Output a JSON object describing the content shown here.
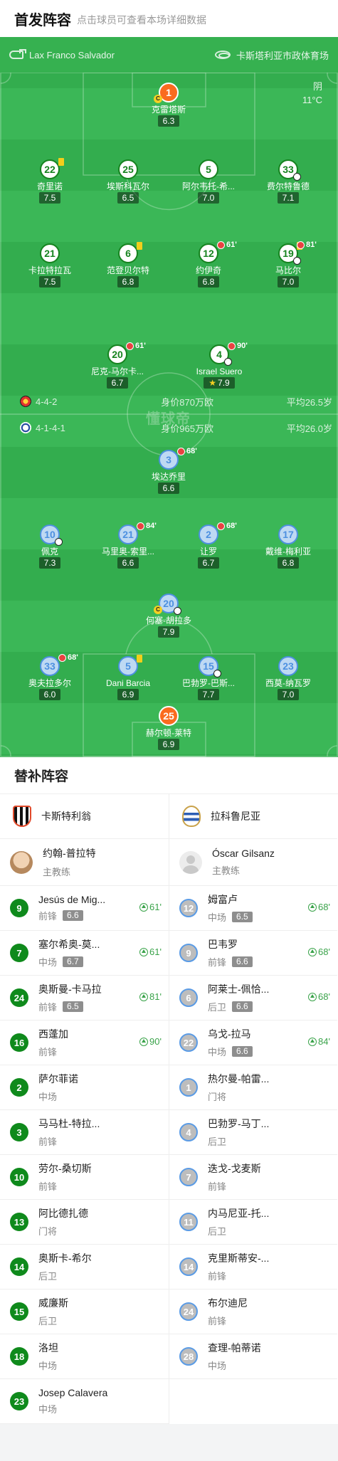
{
  "header": {
    "title": "首发阵容",
    "subtitle": "点击球员可查看本场详细数据"
  },
  "match": {
    "referee": "Lax Franco Salvador",
    "stadium": "卡斯塔利亚市政体育场",
    "weather": "阴",
    "temperature": "11°C",
    "watermark": "懂球帝"
  },
  "home_summary": {
    "formation": "4-4-2",
    "value": "身价870万欧",
    "avg_age": "平均26.5岁"
  },
  "away_summary": {
    "formation": "4-1-4-1",
    "value": "身价965万欧",
    "avg_age": "平均26.0岁"
  },
  "home_players": [
    {
      "num": "1",
      "name": "克雷塔斯",
      "rating": "6.3",
      "captain": true
    },
    {
      "num": "22",
      "name": "奇里诺",
      "rating": "7.5",
      "yellow": true
    },
    {
      "num": "25",
      "name": "埃斯科瓦尔",
      "rating": "6.5"
    },
    {
      "num": "5",
      "name": "阿尔韦托-希...",
      "rating": "7.0"
    },
    {
      "num": "33",
      "name": "费尔特鲁德",
      "rating": "7.1",
      "goal": true
    },
    {
      "num": "21",
      "name": "卡拉特拉瓦",
      "rating": "7.5"
    },
    {
      "num": "6",
      "name": "范登贝尔特",
      "rating": "6.8",
      "yellow": true
    },
    {
      "num": "12",
      "name": "约伊奇",
      "rating": "6.8",
      "sub_off": "61'"
    },
    {
      "num": "19",
      "name": "马比尔",
      "rating": "7.0",
      "yellow": true,
      "sub_off": "81'",
      "goal": true
    },
    {
      "num": "20",
      "name": "尼克-马尔卡...",
      "rating": "6.7",
      "sub_off": "61'"
    },
    {
      "num": "4",
      "name": "Israel Suero",
      "rating": "7.9",
      "sub_off": "90'",
      "goal": true,
      "star": true
    }
  ],
  "away_players": [
    {
      "num": "3",
      "name": "埃达乔里",
      "rating": "6.6",
      "sub_off": "68'"
    },
    {
      "num": "10",
      "name": "佩克",
      "rating": "7.3",
      "goal": true
    },
    {
      "num": "21",
      "name": "马里奥-索里...",
      "rating": "6.6",
      "sub_off": "84'"
    },
    {
      "num": "2",
      "name": "让罗",
      "rating": "6.7",
      "sub_off": "68'"
    },
    {
      "num": "17",
      "name": "戴维-梅利亚",
      "rating": "6.8"
    },
    {
      "num": "20",
      "name": "何塞-胡拉多",
      "rating": "7.9",
      "captain": true,
      "goal": true
    },
    {
      "num": "33",
      "name": "奥夫拉多尔",
      "rating": "6.0",
      "sub_off": "68'"
    },
    {
      "num": "5",
      "name": "Dani Barcia",
      "rating": "6.9",
      "yellow": true
    },
    {
      "num": "15",
      "name": "巴勃罗-巴斯...",
      "rating": "7.7",
      "goal": true
    },
    {
      "num": "23",
      "name": "西莫-纳瓦罗",
      "rating": "7.0"
    },
    {
      "num": "25",
      "name": "赫尔顿-莱特",
      "rating": "6.9"
    }
  ],
  "subs": {
    "title": "替补阵容",
    "home_team": "卡斯特利翁",
    "away_team": "拉科鲁尼亚",
    "home_coach": {
      "name": "约翰-普拉特",
      "role": "主教练"
    },
    "away_coach": {
      "name": "Óscar Gilsanz",
      "role": "主教练"
    },
    "home": [
      {
        "num": "9",
        "name": "Jesús de Mig...",
        "pos": "前锋",
        "rating": "6.6",
        "in": "61'"
      },
      {
        "num": "7",
        "name": "塞尔希奥-莫...",
        "pos": "中场",
        "rating": "6.7",
        "in": "61'"
      },
      {
        "num": "24",
        "name": "奥斯曼-卡马拉",
        "pos": "前锋",
        "rating": "6.5",
        "in": "81'"
      },
      {
        "num": "16",
        "name": "西蓬加",
        "pos": "前锋",
        "rating": "",
        "in": "90'"
      },
      {
        "num": "2",
        "name": "萨尔菲诺",
        "pos": "中场",
        "rating": "",
        "in": ""
      },
      {
        "num": "3",
        "name": "马马杜-特拉...",
        "pos": "前锋",
        "rating": "",
        "in": ""
      },
      {
        "num": "10",
        "name": "劳尔-桑切斯",
        "pos": "前锋",
        "rating": "",
        "in": ""
      },
      {
        "num": "13",
        "name": "阿比德扎德",
        "pos": "门将",
        "rating": "",
        "in": ""
      },
      {
        "num": "14",
        "name": "奥斯卡-希尔",
        "pos": "后卫",
        "rating": "",
        "in": ""
      },
      {
        "num": "15",
        "name": "威廉斯",
        "pos": "后卫",
        "rating": "",
        "in": ""
      },
      {
        "num": "18",
        "name": "洛坦",
        "pos": "中场",
        "rating": "",
        "in": ""
      },
      {
        "num": "23",
        "name": "Josep Calavera",
        "pos": "中场",
        "rating": "",
        "in": ""
      }
    ],
    "away": [
      {
        "num": "12",
        "name": "姆富卢",
        "pos": "中场",
        "rating": "6.5",
        "in": "68'"
      },
      {
        "num": "9",
        "name": "巴韦罗",
        "pos": "前锋",
        "rating": "6.6",
        "in": "68'"
      },
      {
        "num": "6",
        "name": "阿莱士-佩恰...",
        "pos": "后卫",
        "rating": "6.6",
        "in": "68'"
      },
      {
        "num": "22",
        "name": "乌戈-拉马",
        "pos": "中场",
        "rating": "6.6",
        "in": "84'"
      },
      {
        "num": "1",
        "name": "热尔曼-帕雷...",
        "pos": "门将",
        "rating": "",
        "in": ""
      },
      {
        "num": "4",
        "name": "巴勃罗-马丁...",
        "pos": "后卫",
        "rating": "",
        "in": ""
      },
      {
        "num": "7",
        "name": "迭戈-戈麦斯",
        "pos": "前锋",
        "rating": "",
        "in": ""
      },
      {
        "num": "11",
        "name": "内马尼亚-托...",
        "pos": "后卫",
        "rating": "",
        "in": ""
      },
      {
        "num": "14",
        "name": "克里斯蒂安-...",
        "pos": "前锋",
        "rating": "",
        "in": ""
      },
      {
        "num": "24",
        "name": "布尔迪尼",
        "pos": "前锋",
        "rating": "",
        "in": ""
      },
      {
        "num": "28",
        "name": "查理-帕蒂诺",
        "pos": "中场",
        "rating": "",
        "in": ""
      }
    ]
  }
}
